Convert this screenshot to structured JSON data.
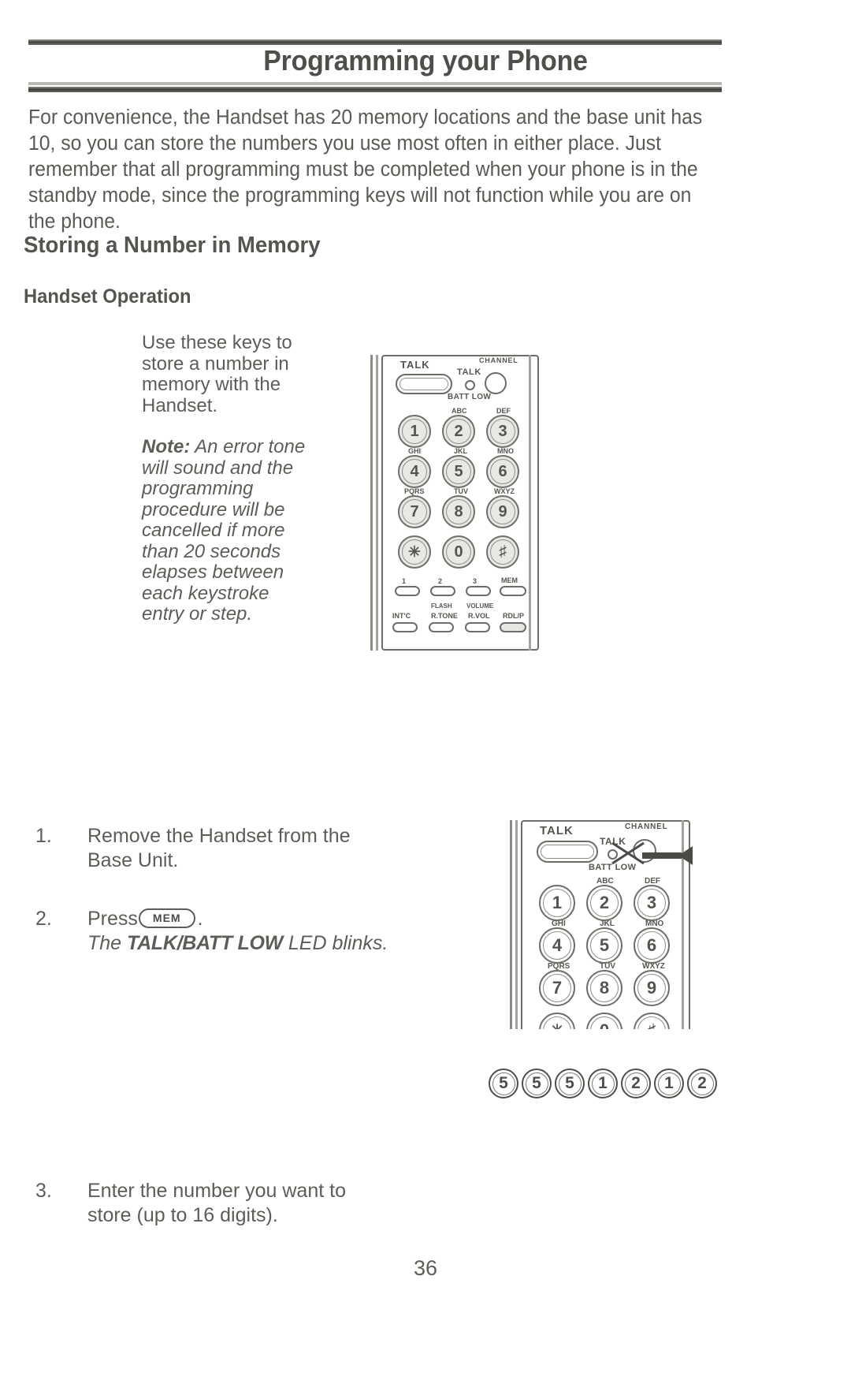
{
  "document": {
    "title": "Programming your Phone",
    "page_number": "36",
    "intro_paragraph": "For convenience, the Handset has 20 memory locations and the base unit has 10, so you can store the numbers you use most often in either place. Just remember that all programming must be completed when your phone is in the standby mode, since the programming keys will not function while you are on the phone.",
    "section_heading": "Storing a Number in Memory",
    "subsection_heading": "Handset Operation"
  },
  "caption": {
    "intro": "Use these keys to store a number in memory with the Handset.",
    "note_label": "Note:",
    "note_text": " An error tone will sound and the programming procedure will be cancelled if more than 20 seconds elapses between each keystroke entry or step."
  },
  "steps": [
    {
      "number": "1.",
      "text": "Remove the Handset from the Base Unit."
    },
    {
      "number": "2.",
      "text_before": "Press",
      "button_label": "MEM",
      "text_after": ".",
      "italic_prefix": "The ",
      "italic_bold": "TALK/BATT LOW",
      "italic_suffix": " LED blinks."
    },
    {
      "number": "3.",
      "text": "Enter the number you want to store (up to 16 digits)."
    }
  ],
  "entered_digits": [
    "5",
    "5",
    "5",
    "1",
    "2",
    "1",
    "2"
  ],
  "handset": {
    "talk_button_label": "TALK",
    "channel_button_label": "CHANNEL",
    "led_top_label": "TALK",
    "led_bottom_label": "BATT LOW",
    "keypad": [
      {
        "digit": "1",
        "letters": ""
      },
      {
        "digit": "2",
        "letters": "ABC"
      },
      {
        "digit": "3",
        "letters": "DEF"
      },
      {
        "digit": "4",
        "letters": "GHI"
      },
      {
        "digit": "5",
        "letters": "JKL"
      },
      {
        "digit": "6",
        "letters": "MNO"
      },
      {
        "digit": "7",
        "letters": "PQRS"
      },
      {
        "digit": "8",
        "letters": "TUV"
      },
      {
        "digit": "9",
        "letters": "WXYZ"
      },
      {
        "digit": "✳",
        "letters": ""
      },
      {
        "digit": "0",
        "letters": ""
      },
      {
        "digit": "♯",
        "letters": ""
      }
    ],
    "memory_row_labels": [
      "1",
      "2",
      "3",
      "MEM"
    ],
    "function_row_labels": [
      "INT'C",
      "FLASH R.TONE",
      "VOLUME R.VOL",
      "RDL/P"
    ],
    "function_row_top_labels": [
      "",
      "FLASH",
      "VOLUME",
      ""
    ],
    "function_row_bottom_labels": [
      "INT'C",
      "R.TONE",
      "R.VOL",
      "RDL/P"
    ]
  },
  "colors": {
    "ink": "#5d5d58",
    "rule_dark": "#3f3f3c",
    "key_fill": "#e8e8e4"
  }
}
